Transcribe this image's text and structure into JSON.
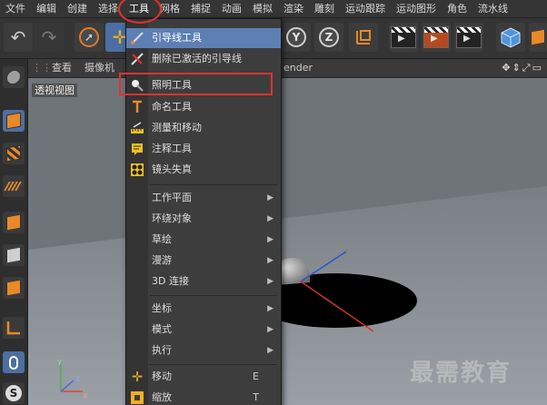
{
  "menubar": {
    "items": [
      "文件",
      "编辑",
      "创建",
      "选择",
      "工具",
      "网格",
      "捕捉",
      "动画",
      "模拟",
      "渲染",
      "雕刻",
      "运动跟踪",
      "运动图形",
      "角色",
      "流水线"
    ]
  },
  "toolbar": {
    "icons": [
      "undo-icon",
      "redo-icon",
      "live-selection-icon",
      "move-icon",
      "scale-icon",
      "rotate-icon",
      "axis-x-icon",
      "axis-y-icon",
      "axis-z-icon",
      "coordinate-system-icon",
      "render-view-icon",
      "render-picture-viewer-icon",
      "edit-render-settings-icon",
      "cube-primitive-icon"
    ],
    "axis_labels": {
      "y": "Y",
      "z": "Z"
    }
  },
  "viewport": {
    "header": {
      "view": "查看",
      "camera": "摄像机",
      "render_fragment": "ender"
    },
    "label": "透视视图",
    "watermark": "最需教育",
    "axis_labels": {
      "x": "X",
      "y": "Y",
      "z": "Z"
    }
  },
  "tools_menu": {
    "items": [
      {
        "label": "引导线工具",
        "icon": "guide-tool-icon",
        "highlighted": true
      },
      {
        "label": "删除已激活的引导线",
        "icon": "delete-guide-icon"
      },
      {
        "label": "照明工具",
        "icon": "lighting-tool-icon"
      },
      {
        "label": "命名工具",
        "icon": "naming-tool-icon"
      },
      {
        "label": "测量和移动",
        "icon": "measure-icon"
      },
      {
        "label": "注释工具",
        "icon": "annotation-icon"
      },
      {
        "label": "镜头失真",
        "icon": "lens-distortion-icon"
      },
      {
        "label": "工作平面",
        "submenu": true
      },
      {
        "label": "环绕对象",
        "submenu": true
      },
      {
        "label": "草绘",
        "submenu": true
      },
      {
        "label": "漫游",
        "submenu": true
      },
      {
        "label": "3D 连接",
        "submenu": true
      },
      {
        "label": "坐标",
        "submenu": true
      },
      {
        "label": "模式",
        "submenu": true
      },
      {
        "label": "执行",
        "submenu": true
      },
      {
        "label": "移动",
        "icon": "move-icon",
        "shortcut": "E"
      },
      {
        "label": "缩放",
        "icon": "scale-icon",
        "shortcut": "T"
      }
    ]
  },
  "colors": {
    "accent": "#5d7fb3",
    "annotation": "#e0312f",
    "orange": "#e8892a"
  }
}
